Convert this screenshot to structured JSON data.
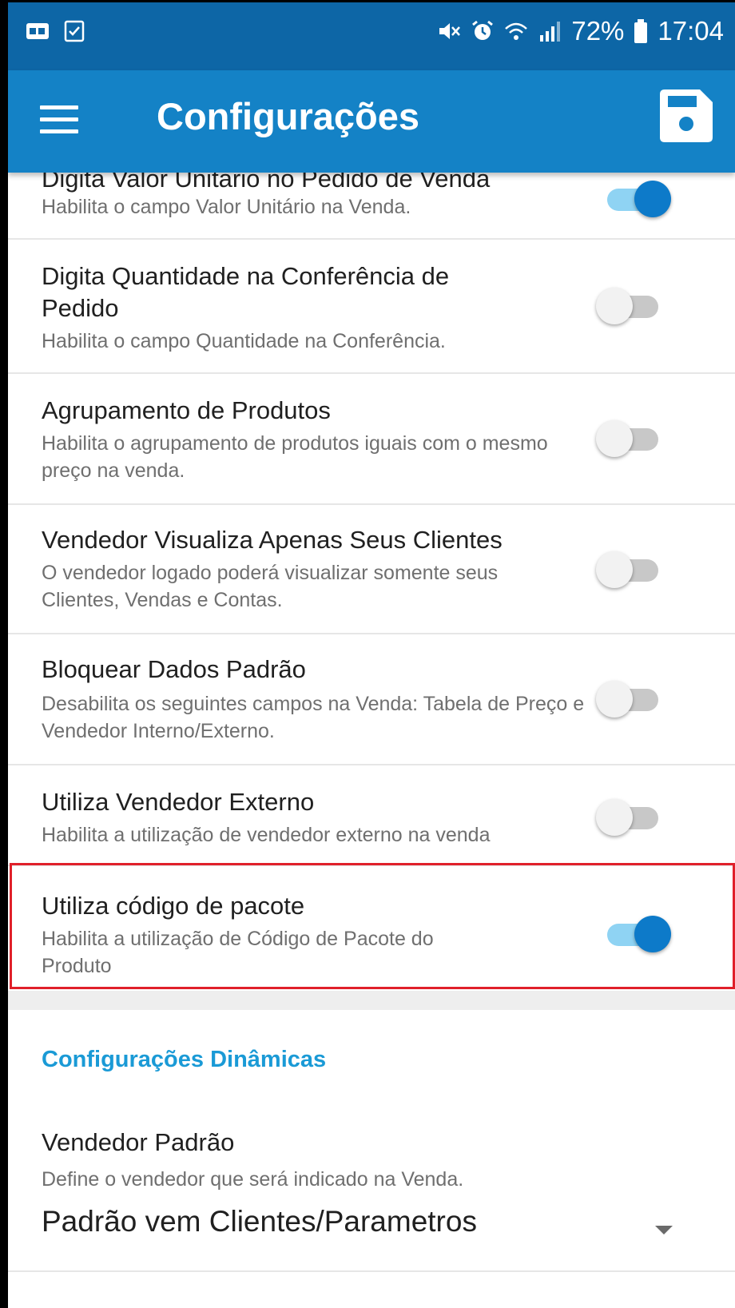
{
  "statusbar": {
    "battery_percent": "72%",
    "time": "17:04"
  },
  "appbar": {
    "title": "Configurações",
    "menu_icon": "hamburger-menu-icon",
    "save_icon": "floppy-save-icon"
  },
  "settings": [
    {
      "title": "Digita Valor Unitário no Pedido de Venda",
      "subtitle": "Habilita o campo Valor Unitário na Venda.",
      "enabled": true
    },
    {
      "title": "Digita Quantidade na Conferência de Pedido",
      "subtitle": "Habilita o campo Quantidade na Conferência.",
      "enabled": false
    },
    {
      "title": "Agrupamento de Produtos",
      "subtitle": "Habilita o agrupamento de produtos iguais com o mesmo preço na venda.",
      "enabled": false
    },
    {
      "title": "Vendedor Visualiza Apenas Seus Clientes",
      "subtitle": "O vendedor logado poderá visualizar somente seus Clientes, Vendas e Contas.",
      "enabled": false
    },
    {
      "title": "Bloquear Dados Padrão",
      "subtitle": "Desabilita os seguintes campos na Venda: Tabela de Preço e Vendedor Interno/Externo.",
      "enabled": false
    },
    {
      "title": "Utiliza Vendedor Externo",
      "subtitle": "Habilita a utilização de vendedor externo na venda",
      "enabled": false
    },
    {
      "title": "Utiliza código de pacote",
      "subtitle": "Habilita a utilização de Código de Pacote do Produto",
      "enabled": true
    }
  ],
  "dynamic": {
    "section_title": "Configurações Dinâmicas",
    "vendedor_padrao": {
      "title": "Vendedor Padrão",
      "subtitle": "Define o vendedor que será indicado na Venda.",
      "selected": "Padrão vem Clientes/Parametros"
    }
  },
  "colors": {
    "statusbar": "#0d66a6",
    "appbar": "#1482c6",
    "accent": "#0d7ac9",
    "section_title": "#1a9ad6",
    "highlight": "#e0202a"
  }
}
